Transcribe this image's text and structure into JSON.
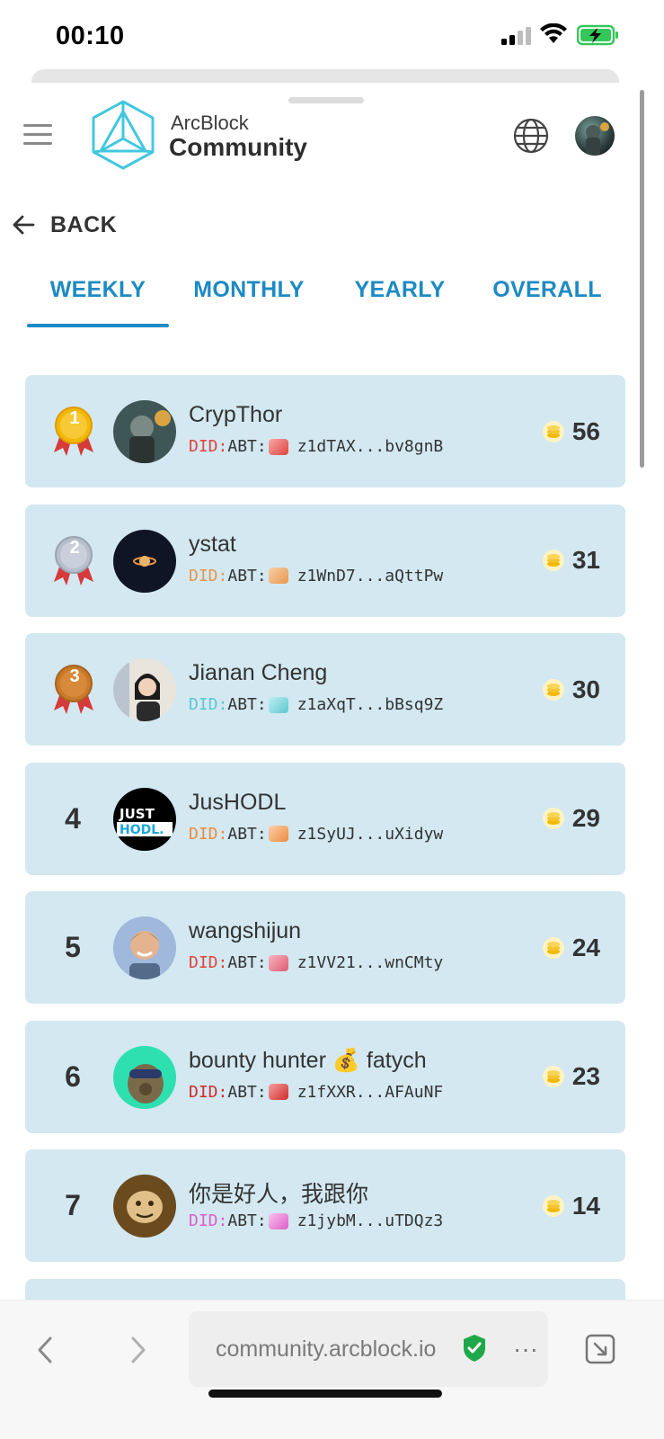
{
  "status_bar": {
    "time": "00:10"
  },
  "header": {
    "brand_top": "ArcBlock",
    "brand_main": "Community"
  },
  "back": {
    "label": "BACK"
  },
  "tabs": [
    {
      "label": "WEEKLY",
      "active": true
    },
    {
      "label": "MONTHLY",
      "active": false
    },
    {
      "label": "YEARLY",
      "active": false
    },
    {
      "label": "OVERALL",
      "active": false
    }
  ],
  "leaderboard": [
    {
      "rank": "1",
      "name": "CrypThor",
      "did_prefix": "DID:",
      "did_abt": "ABT:",
      "did_value": "z1dTAX...bv8gnB",
      "score": "56",
      "did_color": "#e0443c"
    },
    {
      "rank": "2",
      "name": "ystat",
      "did_prefix": "DID:",
      "did_abt": "ABT:",
      "did_value": "z1WnD7...aQttPw",
      "score": "31",
      "did_color": "#e8964a"
    },
    {
      "rank": "3",
      "name": "Jianan Cheng",
      "did_prefix": "DID:",
      "did_abt": "ABT:",
      "did_value": "z1aXqT...bBsq9Z",
      "score": "30",
      "did_color": "#5cc8d0"
    },
    {
      "rank": "4",
      "name": "JusHODL",
      "did_prefix": "DID:",
      "did_abt": "ABT:",
      "did_value": "z1SyUJ...uXidyw",
      "score": "29",
      "did_color": "#ee8a3c"
    },
    {
      "rank": "5",
      "name": "wangshijun",
      "did_prefix": "DID:",
      "did_abt": "ABT:",
      "did_value": "z1VV21...wnCMty",
      "score": "24",
      "did_color": "#e0443c"
    },
    {
      "rank": "6",
      "name": "bounty hunter 💰 fatych",
      "did_prefix": "DID:",
      "did_abt": "ABT:",
      "did_value": "z1fXXR...AFAuNF",
      "score": "23",
      "did_color": "#d02a2a"
    },
    {
      "rank": "7",
      "name": "你是好人，我跟你",
      "did_prefix": "DID:",
      "did_abt": "ABT:",
      "did_value": "z1jybM...uTDQz3",
      "score": "14",
      "did_color": "#e05cc8"
    }
  ],
  "browser": {
    "url": "community.arcblock.io",
    "more": "···"
  },
  "colors": {
    "accent": "#1d8ac4",
    "row_bg": "#d3e8f1",
    "gold": "#f2b807",
    "silver": "#b7bfcc",
    "bronze": "#c87a2a"
  }
}
